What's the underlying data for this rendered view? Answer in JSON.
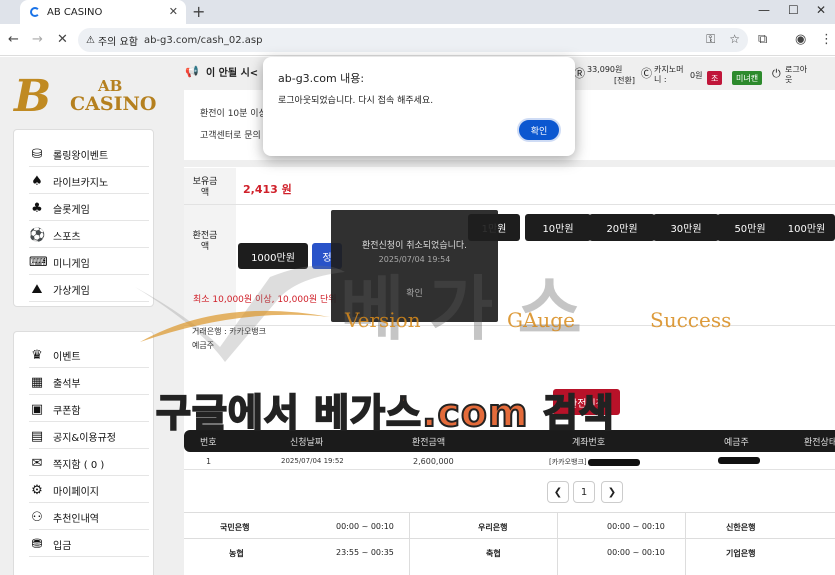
{
  "browser": {
    "tab_title": "AB CASINO",
    "warning_label": "주의 요함",
    "url": "ab-g3.com/cash_02.asp"
  },
  "logo": {
    "mark": "B",
    "line1": "AB",
    "line2": "CASINO"
  },
  "header": {
    "notice": "이 안될 시<",
    "balance_amount": "33,090원",
    "balance_sub": "[전환]",
    "casino_money_label": "카지노머니 :",
    "casino_money_value": "0원",
    "badge1": "조",
    "badge2": "미녀캔",
    "logout": "로그아웃"
  },
  "sidebar": {
    "games": [
      {
        "icon": "rolling-event-icon",
        "glyph": "⛁",
        "label": "롤링왕이벤트"
      },
      {
        "icon": "spade-icon",
        "glyph": "♠",
        "label": "라이브카지노"
      },
      {
        "icon": "cherry-icon",
        "glyph": "♣",
        "label": "슬롯게임"
      },
      {
        "icon": "soccer-ball-icon",
        "glyph": "⚽",
        "label": "스포츠"
      },
      {
        "icon": "gamepad-icon",
        "glyph": "⌨",
        "label": "미니게임"
      },
      {
        "icon": "virtual-game-icon",
        "glyph": "⛰",
        "label": "가상게임"
      }
    ],
    "menu": [
      {
        "icon": "event-icon",
        "glyph": "♛",
        "label": "이벤트"
      },
      {
        "icon": "calendar-icon",
        "glyph": "▦",
        "label": "출석부"
      },
      {
        "icon": "coupon-icon",
        "glyph": "▣",
        "label": "쿠폰함"
      },
      {
        "icon": "notice-icon",
        "glyph": "▤",
        "label": "공지&이용규정"
      },
      {
        "icon": "mail-icon",
        "glyph": "✉",
        "label": "쪽지함 ( 0 )"
      },
      {
        "icon": "user-settings-icon",
        "glyph": "⚙",
        "label": "마이페이지"
      },
      {
        "icon": "referral-icon",
        "glyph": "⚇",
        "label": "추천인내역"
      },
      {
        "icon": "deposit-icon",
        "glyph": "⛃",
        "label": "입금"
      }
    ]
  },
  "notices": {
    "line1": "환전이 10분 이상",
    "line2": "고객센터로 문의"
  },
  "form": {
    "balance_label": "보유금액",
    "balance_value": "2,413 원",
    "amount_label": "환전금액",
    "amount_buttons": [
      "1만원",
      "10만원",
      "20만원",
      "30만원",
      "50만원",
      "100만원"
    ],
    "btn_1000": "1000만원",
    "btn_blue": "정",
    "min_note": "최소 10,000원 이상, 10,000원 단위",
    "bank_label": "거래은행 : 카카오뱅크",
    "holder_label": "예금주",
    "submit": "환전신청"
  },
  "table": {
    "headers": [
      "번호",
      "신청날짜",
      "환전금액",
      "계좌번호",
      "예금주",
      "환전상태"
    ],
    "rows": [
      {
        "no": "1",
        "date": "2025/07/04 19:52",
        "amount": "2,600,000",
        "account": "[카카오뱅크]"
      }
    ],
    "page": "1"
  },
  "banks": [
    {
      "bank": "국민은행",
      "time": "00:00 ~ 00:10"
    },
    {
      "bank": "우리은행",
      "time": "00:00 ~ 00:10"
    },
    {
      "bank": "신한은행",
      "time": ""
    },
    {
      "bank": "농협",
      "time": "23:55 ~ 00:35"
    },
    {
      "bank": "축협",
      "time": "00:00 ~ 00:10"
    },
    {
      "bank": "기업은행",
      "time": ""
    }
  ],
  "toast": {
    "message": "환전신청이 취소되었습니다.",
    "time": "2025/07/04 19:54",
    "confirm": "확인"
  },
  "dialog": {
    "title": "ab-g3.com 내용:",
    "message": "로그아웃되었습니다.  다시 접속 해주세요.",
    "ok": "확인"
  },
  "watermark": {
    "big_prefix": "구글에서 ",
    "big_accent": "베가스.com",
    "big_suffix": " 검색",
    "word1": "Version",
    "word2": "GAuge",
    "word3": "Success",
    "korean": "베  가  스"
  }
}
